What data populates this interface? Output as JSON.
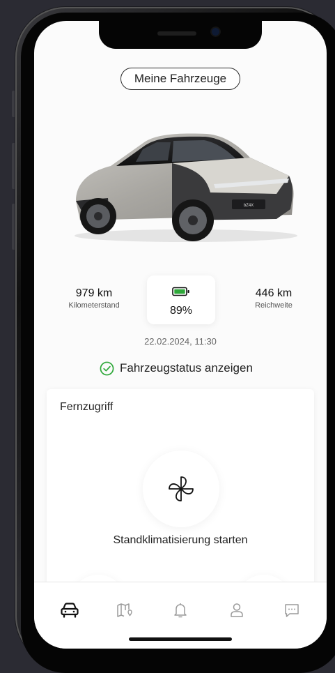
{
  "header": {
    "my_vehicles_button": "Meine Fahrzeuge"
  },
  "car": {
    "badge": "bZ4X"
  },
  "stats": {
    "mileage_value": "979 km",
    "mileage_label": "Kilometerstand",
    "battery_percent": "89%",
    "range_value": "446 km",
    "range_label": "Reichweite"
  },
  "status": {
    "timestamp": "22.02.2024, 11:30",
    "link_label": "Fahrzeugstatus anzeigen"
  },
  "remote": {
    "title": "Fernzugriff",
    "climate_label": "Standklimatisierung starten"
  },
  "tabbar": {
    "items": [
      "car-icon",
      "map-icon",
      "bell-icon",
      "profile-icon",
      "chat-icon"
    ],
    "active_index": 0
  },
  "colors": {
    "battery": "#2fa83a",
    "status_check": "#2fa83a",
    "accent": "#111111"
  }
}
